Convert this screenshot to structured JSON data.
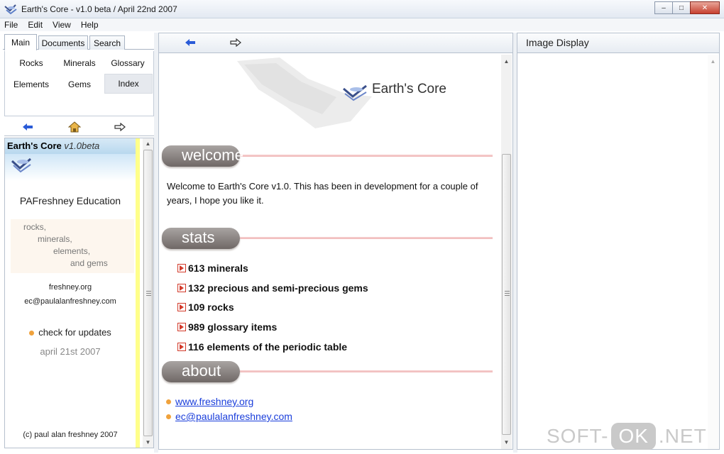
{
  "window": {
    "title": "Earth's Core - v1.0 beta / April 22nd 2007",
    "controls": [
      "minimize",
      "maximize",
      "close"
    ]
  },
  "menu": [
    "File",
    "Edit",
    "View",
    "Help"
  ],
  "left_panel": {
    "tabs": [
      {
        "label": "Main",
        "active": true
      },
      {
        "label": "Documents",
        "active": false
      },
      {
        "label": "Search",
        "active": false
      }
    ],
    "nav_items": [
      {
        "label": "Rocks",
        "selected": false
      },
      {
        "label": "Minerals",
        "selected": false
      },
      {
        "label": "Glossary",
        "selected": false
      },
      {
        "label": "Elements",
        "selected": false
      },
      {
        "label": "Gems",
        "selected": false
      },
      {
        "label": "Index",
        "selected": true
      }
    ],
    "nav_icons": [
      "back-arrow-icon",
      "home-icon",
      "forward-arrow-icon"
    ],
    "content": {
      "heading_name": "Earth's Core",
      "heading_version": "v1.0beta",
      "org": "PAFreshney Education",
      "topics": [
        "rocks,",
        "minerals,",
        "elements,",
        "and gems"
      ],
      "site": "freshney.org",
      "email": "ec@paulalanfreshney.com",
      "update_label": "check for updates",
      "date": "april 21st 2007",
      "copyright": "(c) paul alan freshney 2007"
    }
  },
  "main_panel": {
    "toolbar_icons": [
      "back-arrow-icon",
      "forward-arrow-icon"
    ],
    "logo_title": "Earth's Core",
    "sections": {
      "welcome": "welcome",
      "stats": "stats",
      "about": "about"
    },
    "welcome_text": "Welcome to Earth's Core v1.0. This has been in development for a couple of years, I hope you like it.",
    "stats": [
      "613 minerals",
      "132 precious and semi-precious gems",
      "109 rocks",
      "989 glossary items",
      "116 elements of the periodic table"
    ],
    "about_links": [
      "www.freshney.org",
      "ec@paulalanfreshney.com"
    ]
  },
  "image_panel": {
    "title": "Image Display"
  },
  "site_watermark": {
    "before": "SOFT-",
    "badge": "OK",
    "after": ".NET"
  },
  "colors": {
    "link": "#1a3edb",
    "bullet": "#f0a23c",
    "stat_icon": "#d23a2a",
    "section_pill": "#8a8482",
    "scroll_strip": "#ffff8a"
  }
}
